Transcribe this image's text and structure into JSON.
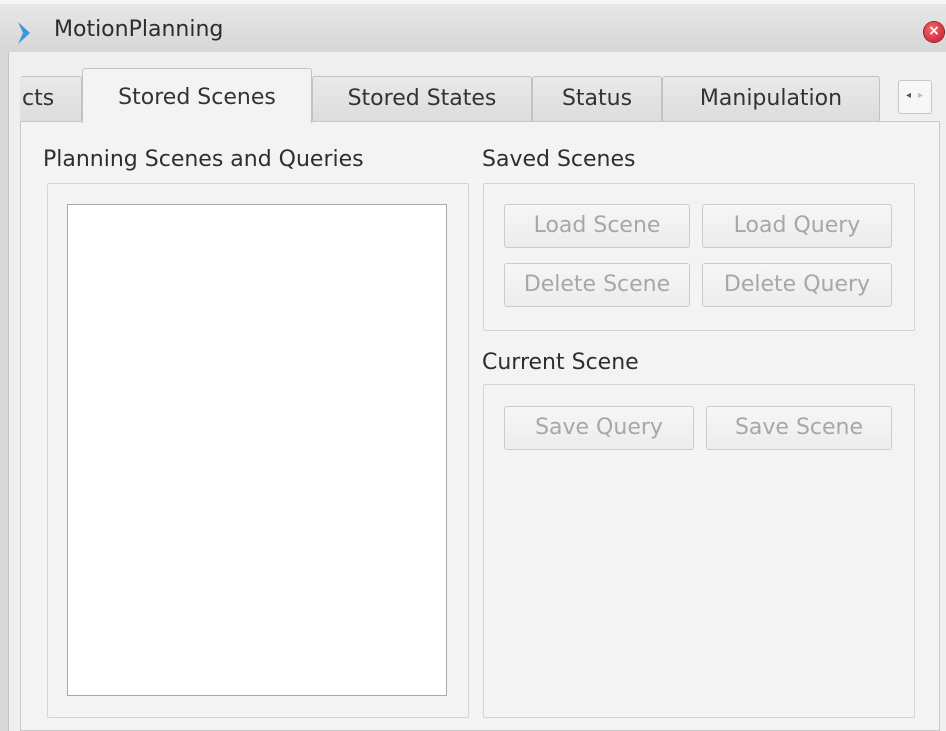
{
  "window": {
    "title": "MotionPlanning"
  },
  "tabs": [
    {
      "label": "cts"
    },
    {
      "label": "Stored Scenes"
    },
    {
      "label": "Stored States"
    },
    {
      "label": "Status"
    },
    {
      "label": "Manipulation"
    }
  ],
  "tab_scroll": {
    "left": "◂",
    "right": "▸"
  },
  "planning_scenes": {
    "label": "Planning Scenes and Queries"
  },
  "saved_scenes": {
    "label": "Saved Scenes",
    "load_scene": "Load Scene",
    "load_query": "Load Query",
    "delete_scene": "Delete Scene",
    "delete_query": "Delete Query"
  },
  "current_scene": {
    "label": "Current Scene",
    "save_query": "Save Query",
    "save_scene": "Save Scene"
  },
  "colors": {
    "accent": "#3a9ad9",
    "close": "#c7162b"
  }
}
